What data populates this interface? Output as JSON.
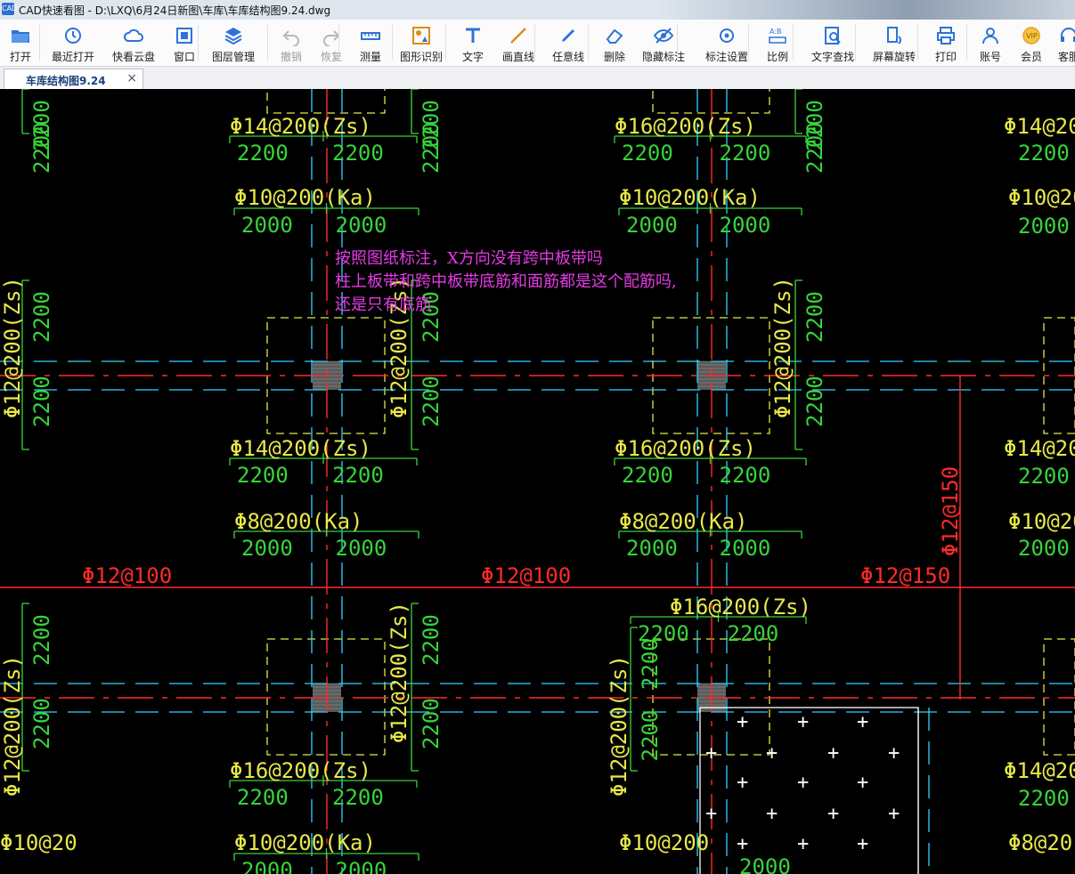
{
  "window": {
    "title": "CAD快速看图 - D:\\LXQ\\6月24日新图\\车库\\车库结构图9.24.dwg",
    "app_icon_text": "CAD"
  },
  "toolbar": {
    "items": [
      {
        "label": "打开",
        "icon": "folder-open-icon"
      },
      {
        "label": "最近打开",
        "icon": "history-icon"
      },
      {
        "label": "快看云盘",
        "icon": "cloud-icon"
      },
      {
        "label": "窗口",
        "icon": "window-icon"
      },
      {
        "label": "图层管理",
        "icon": "layers-icon"
      },
      {
        "label": "撤销",
        "icon": "undo-icon"
      },
      {
        "label": "恢复",
        "icon": "redo-icon"
      },
      {
        "label": "测量",
        "icon": "ruler-icon"
      },
      {
        "label": "图形识别",
        "icon": "shape-recognize-icon"
      },
      {
        "label": "文字",
        "icon": "text-icon"
      },
      {
        "label": "画直线",
        "icon": "line-icon"
      },
      {
        "label": "任意线",
        "icon": "pen-icon"
      },
      {
        "label": "删除",
        "icon": "eraser-icon"
      },
      {
        "label": "隐藏标注",
        "icon": "eye-hide-icon"
      },
      {
        "label": "标注设置",
        "icon": "annotation-settings-icon"
      },
      {
        "label": "比例",
        "icon": "scale-icon"
      },
      {
        "label": "文字查找",
        "icon": "text-search-icon"
      },
      {
        "label": "屏幕旋转",
        "icon": "rotate-screen-icon"
      },
      {
        "label": "打印",
        "icon": "printer-icon"
      },
      {
        "label": "账号",
        "icon": "user-icon"
      },
      {
        "label": "会员",
        "icon": "vip-icon"
      },
      {
        "label": "客服",
        "icon": "headset-icon"
      }
    ]
  },
  "tab": {
    "label": "车库结构图9.24",
    "close": "×"
  },
  "annotation": {
    "line1": "按照图纸标注，X方向没有跨中板带吗",
    "line2": "柱上板带和跨中板带底筋和面筋都是这个配筋吗,",
    "line3": "还是只有底筋"
  },
  "drawing": {
    "rebar_labels": [
      "Φ14@200(Zs)",
      "Φ16@200(Zs)",
      "Φ10@200(Ka)",
      "Φ8@200(Ka)",
      "Φ12@200(Zs)",
      "Φ12@100",
      "Φ12@150",
      "Φ14@200",
      "Φ16@200(Zs)",
      "Φ10@200",
      "Φ8@200",
      "Φ16@200",
      "Φ10@20",
      "Φ14@20",
      "Φ8@20",
      "Φ12@200"
    ],
    "dimensions": [
      "2200",
      "2000"
    ],
    "colors": {
      "background": "#000000",
      "dimension_green": "#37d43a",
      "label_yellow": "#e8e84a",
      "axis_red": "#ff2a2a",
      "dashed_cyan": "#2fd4ff",
      "dashed_yellow": "#e8e84a",
      "note_magenta": "#e53ae5"
    }
  }
}
